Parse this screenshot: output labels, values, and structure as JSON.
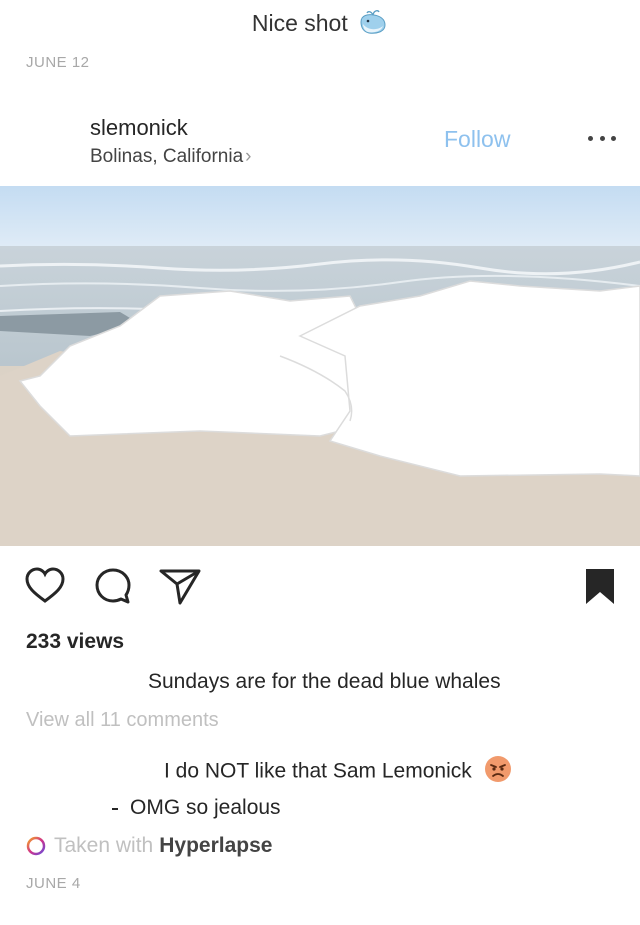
{
  "previous_post": {
    "caption": "Nice shot",
    "caption_emoji": "whale-emoji",
    "date": "JUNE 12"
  },
  "post": {
    "username": "slemonick",
    "location": "Bolinas, California",
    "location_chevron": "›",
    "follow_label": "Follow",
    "more_icon": "more-dots-icon",
    "photo_subject": "beach-ocean-photo",
    "action_icons": [
      "heart-icon",
      "comment-icon",
      "share-icon",
      "bookmark-icon"
    ],
    "views": "233 views",
    "caption": "Sundays are for the dead blue whales",
    "view_all_comments": "View all 11 comments",
    "comments": [
      {
        "text": "I do NOT like that Sam Lemonick",
        "emoji": "angry-face-emoji"
      },
      {
        "text": "OMG so jealous"
      }
    ],
    "taken_with_prefix": "Taken with",
    "taken_with_app": "Hyperlapse",
    "date": "JUNE 4"
  },
  "colors": {
    "follow_blue": "#8ec1ee",
    "muted_gray": "#c0c0c0",
    "text_dark": "#262626"
  }
}
